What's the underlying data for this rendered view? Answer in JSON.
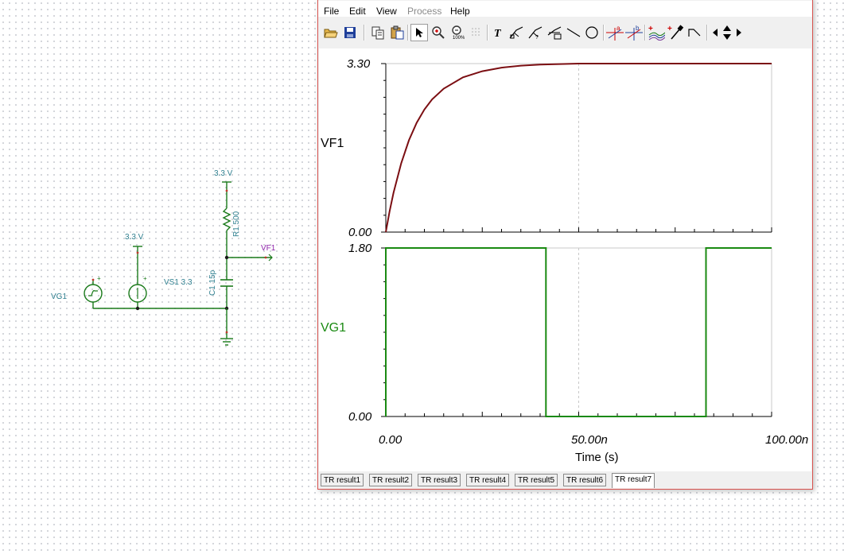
{
  "schematic": {
    "vg1_label": "VG1",
    "vs1_supply_label": "3.3 V",
    "vs1_label": "VS1 3.3",
    "r1_supply_label": "3.3 V",
    "r1_label": "R1 500",
    "c1_label": "C1 15p",
    "vf1_label": "VF1"
  },
  "menu": {
    "file": "File",
    "edit": "Edit",
    "view": "View",
    "process": "Process",
    "help": "Help"
  },
  "toolbar": {
    "icons": [
      "open-icon",
      "save-icon",
      "copy-icon",
      "paste-icon",
      "pointer-icon",
      "zoom-in-icon",
      "zoom-100-icon",
      "grid-icon",
      "text-icon",
      "cursor-tool-1-icon",
      "cursor-tool-2-icon",
      "cursor-tool-3-icon",
      "line-icon",
      "circle-icon",
      "cursor-a-icon",
      "cursor-b-icon",
      "add-curve-icon",
      "add-probe-icon",
      "step-icon",
      "arrow-left-icon",
      "arrow-updown-icon",
      "arrow-right-icon"
    ]
  },
  "chart_data": [
    {
      "type": "line",
      "ylabel": "VF1",
      "ylim": [
        0,
        3.3
      ],
      "yticklabels": [
        "3.30",
        "0.00"
      ],
      "xlim": [
        0,
        100
      ],
      "color": "#7b0e12",
      "grid": "vertical dashed at 50.00n",
      "series": [
        {
          "name": "VF1",
          "x": [
            0,
            1,
            2,
            4,
            6,
            8,
            10,
            12,
            15,
            20,
            25,
            30,
            35,
            40,
            50,
            60,
            80,
            100
          ],
          "y": [
            0,
            0.41,
            0.77,
            1.35,
            1.8,
            2.14,
            2.4,
            2.6,
            2.81,
            3.03,
            3.15,
            3.22,
            3.26,
            3.28,
            3.3,
            3.3,
            3.3,
            3.3
          ]
        }
      ]
    },
    {
      "type": "line",
      "ylabel": "VG1",
      "ylim": [
        0,
        1.8
      ],
      "yticklabels": [
        "1.80",
        "0.00"
      ],
      "xlim": [
        0,
        100
      ],
      "xlabel": "Time (s)",
      "xticklabels": [
        "0.00",
        "50.00n",
        "100.00n"
      ],
      "color": "#1a8a12",
      "grid": "vertical dashed at 50.00n",
      "series": [
        {
          "name": "VG1",
          "x": [
            0,
            0,
            41.5,
            41.5,
            83,
            83,
            100
          ],
          "y": [
            0,
            1.8,
            1.8,
            0,
            0,
            1.8,
            1.8
          ]
        }
      ]
    }
  ],
  "tabs": [
    "TR result1",
    "TR result2",
    "TR result3",
    "TR result4",
    "TR result5",
    "TR result6",
    "TR result7"
  ],
  "active_tab": "TR result7"
}
